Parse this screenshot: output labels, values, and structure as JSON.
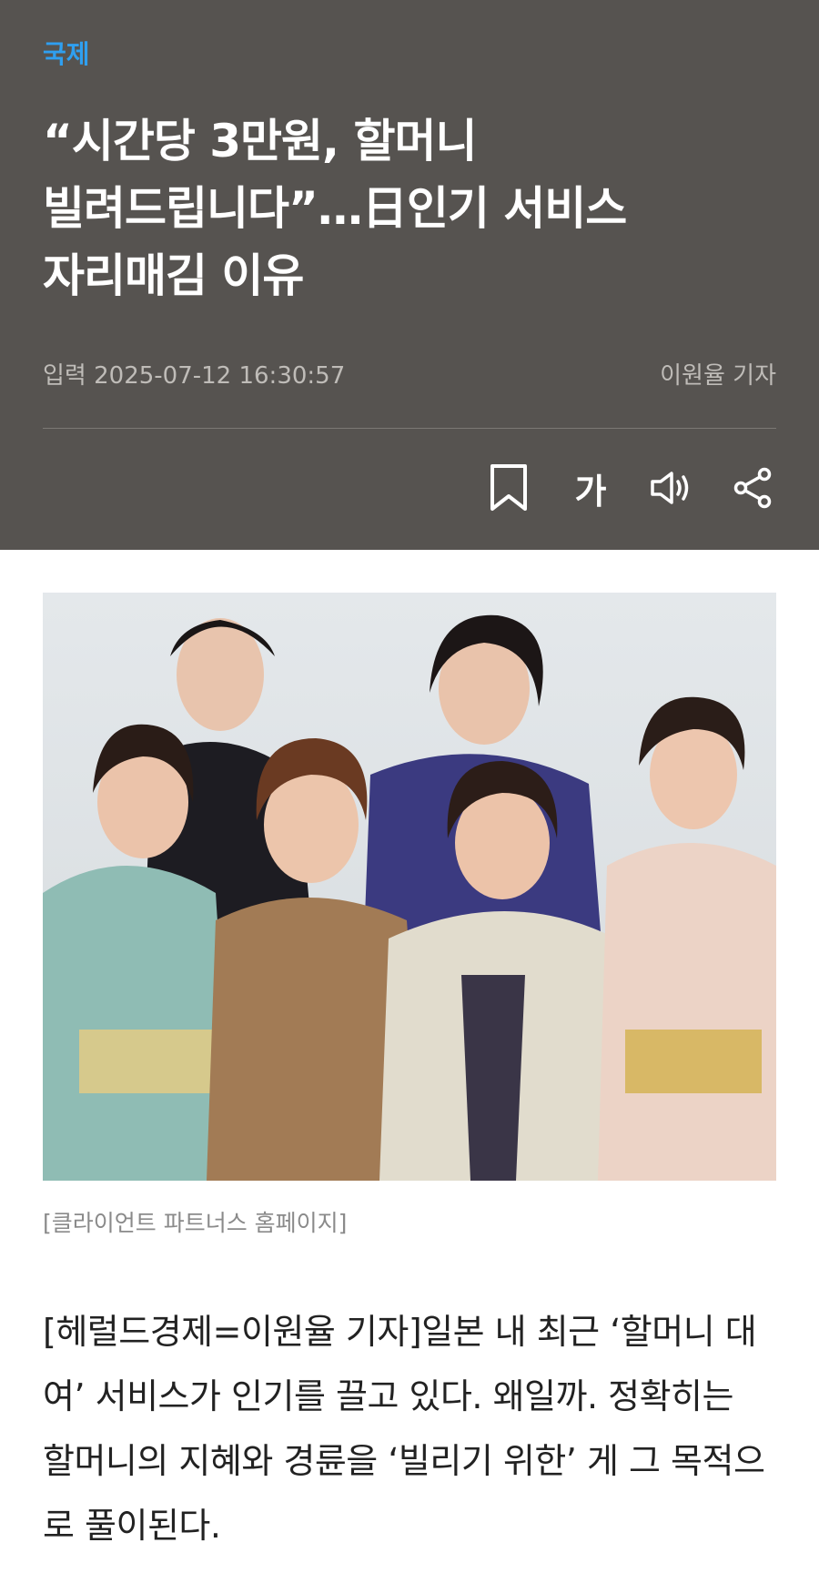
{
  "article": {
    "category": "국제",
    "title_lines": [
      "“시간당 3만원, 할머니",
      "빌려드립니다”…日인기 서비스",
      "자리매김 이유"
    ],
    "published": "입력 2025-07-12 16:30:57",
    "author": "이원율 기자",
    "toolbar": {
      "font_label": "가"
    },
    "image_caption": "[클라이언트 파트너스 홈페이지]",
    "body_lines": [
      "[헤럴드경제=이원율 기자]일본 내 최근 ‘할머니 대",
      "여’ 서비스가 인기를 끌고 있다. 왜일까. 정확히는",
      "할머니의 지혜와 경륜을 ‘빌리기 위한’ 게 그 목적으",
      "로 풀이된다."
    ]
  },
  "colors": {
    "header_bg": "#565350",
    "category": "#2f9ff0",
    "meta_text": "#bfbcb8",
    "body_text": "#222222",
    "caption": "#8a8a8a"
  },
  "icons": [
    "bookmark-icon",
    "speaker-icon",
    "share-icon"
  ]
}
